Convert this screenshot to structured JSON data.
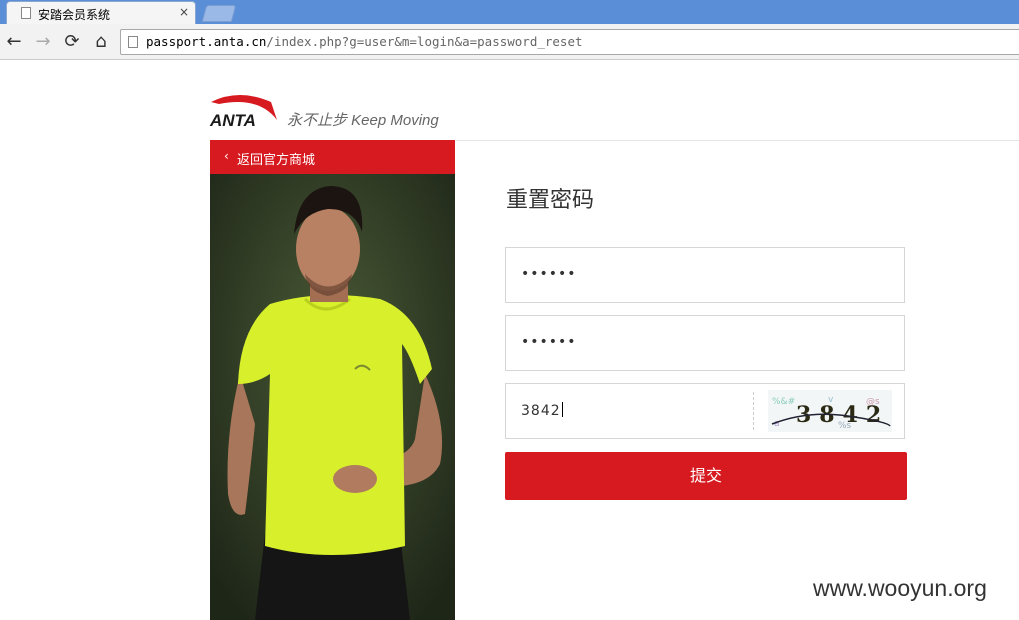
{
  "browser": {
    "tab_title": "安踏会员系统",
    "tab_close": "×",
    "url_host": "passport.anta.cn",
    "url_path": "/index.php?g=user&m=login&a=password_reset",
    "nav": {
      "back": "←",
      "forward": "→",
      "reload": "⟳",
      "home": "⌂"
    }
  },
  "brand": {
    "logo_text": "ANTA",
    "slogan": "永不止步 Keep Moving",
    "accent": "#d71920"
  },
  "left_panel": {
    "back_link": "返回官方商城",
    "chevron": "‹"
  },
  "form": {
    "title": "重置密码",
    "password": "••••••",
    "confirm_password": "••••••",
    "captcha_value": "3842",
    "captcha_image_text": "3842",
    "submit_label": "提交"
  },
  "watermark": "www.wooyun.org"
}
